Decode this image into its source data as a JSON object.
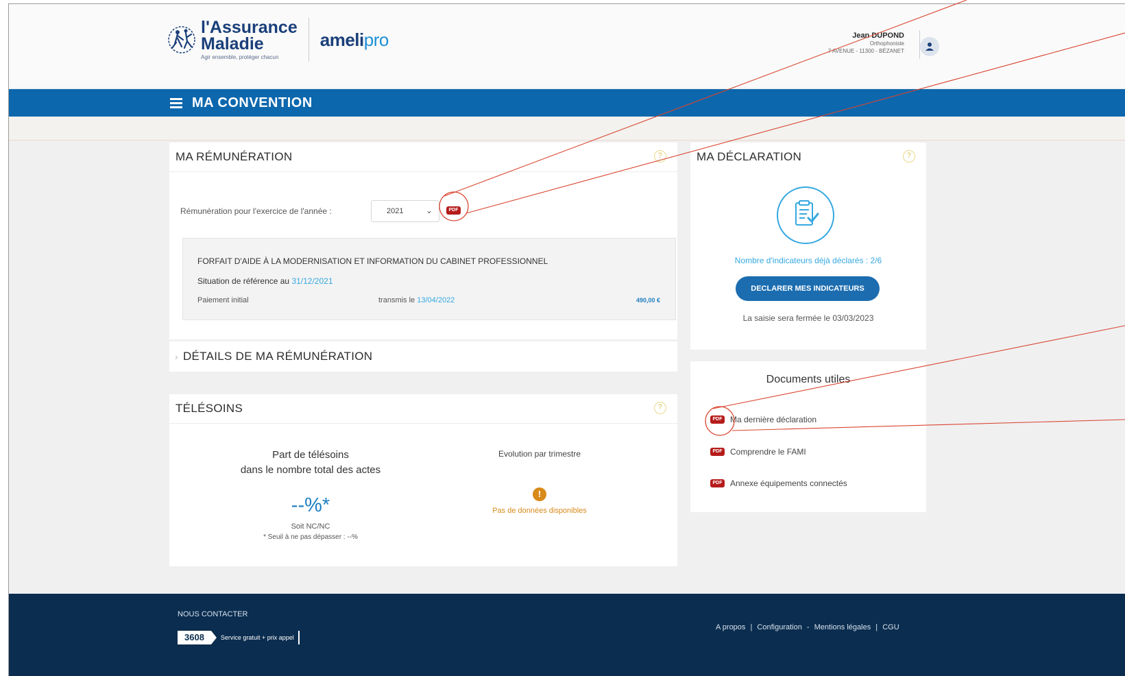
{
  "header": {
    "logo": {
      "line1": "l'Assurance",
      "line2": "Maladie",
      "tagline": "Agir ensemble, protéger chacun"
    },
    "app_name_main": "ameli",
    "app_name_suffix": "pro",
    "user": {
      "name": "Jean DUPOND",
      "role": "Orthophoniste",
      "address": "7 AVENUE - 11300 - BÉZANET"
    },
    "icons": {
      "user": "user-icon"
    }
  },
  "nav": {
    "title": "MA CONVENTION",
    "menu_icon": "hamburger-icon"
  },
  "remuneration": {
    "title": "MA RÉMUNÉRATION",
    "help": "?",
    "year_label": "Rémunération pour l'exercice de l'année :",
    "year_value": "2021",
    "pdf_label": "PDF",
    "forfait": {
      "title": "FORFAIT D'AIDE À LA MODERNISATION ET INFORMATION DU CABINET PROFESSIONNEL",
      "ref_label": "Situation de référence au",
      "ref_date": "31/12/2021",
      "payment_label": "Paiement initial",
      "transmis_label": "transmis le",
      "transmis_date": "13/04/2022",
      "amount": "490,00 €"
    }
  },
  "details": {
    "title": "DÉTAILS DE MA RÉMUNÉRATION"
  },
  "telesoins": {
    "title": "TÉLÉSOINS",
    "help": "?",
    "part_line1": "Part de télésoins",
    "part_line2": "dans le nombre total des actes",
    "percent": "--%*",
    "soit": "Soit NC/NC",
    "seuil": "* Seuil à ne pas dépasser : --%",
    "evolution": "Evolution par trimestre",
    "warning": "!",
    "no_data": "Pas de données disponibles"
  },
  "declaration": {
    "title": "MA DÉCLARATION",
    "help": "?",
    "count_text": "Nombre d'indicateurs déjà déclarés : 2/6",
    "button": "DECLARER MES INDICATEURS",
    "closing": "La saisie sera fermée le 03/03/2023"
  },
  "documents": {
    "title": "Documents utiles",
    "items": [
      {
        "label": "Ma dernière déclaration",
        "badge": "PDF"
      },
      {
        "label": "Comprendre le FAMI",
        "badge": "PDF"
      },
      {
        "label": "Annexe équipements connectés",
        "badge": "PDF"
      }
    ]
  },
  "footer": {
    "contact": "NOUS CONTACTER",
    "phone": "3608",
    "phone_info": "Service gratuit + prix appel",
    "links": [
      "A propos",
      "Configuration",
      "Mentions légales",
      "CGU"
    ],
    "separators": [
      "|",
      "-",
      "|"
    ]
  },
  "colors": {
    "brand_blue": "#0c67ad",
    "accent_blue": "#35a8e0",
    "footer_navy": "#0b2d4f",
    "pdf_red": "#b51b1b",
    "warning_orange": "#d88a1a",
    "annotation_red": "#d9452f"
  }
}
